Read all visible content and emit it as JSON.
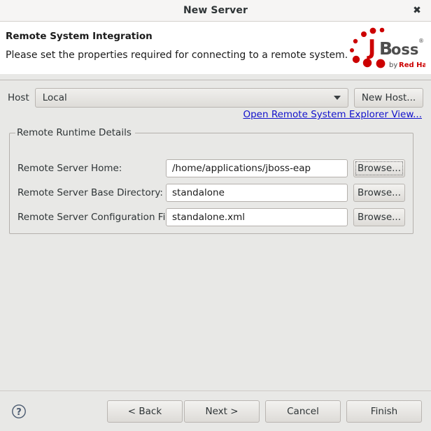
{
  "window": {
    "title": "New Server",
    "close_icon": "close-icon"
  },
  "header": {
    "title": "Remote System Integration",
    "description": "Please set the properties required for connecting to a remote system.",
    "logo": {
      "name": "jboss-logo",
      "wordmark_j": "J",
      "wordmark_boss": "Boss",
      "registered": "®",
      "byline_prefix": "by ",
      "byline_brand": "Red Hat",
      "brand_color": "#cc0000",
      "wordmark_color": "#4d4d4d"
    }
  },
  "host": {
    "label": "Host",
    "selected": "Local",
    "options": [
      "Local"
    ],
    "new_host_button": "New Host...",
    "explorer_link": "Open Remote System Explorer View...",
    "link_color": "#1111cc"
  },
  "runtime_group": {
    "legend": "Remote Runtime Details",
    "fields": [
      {
        "label": "Remote Server Home:",
        "value": "/home/applications/jboss-eap",
        "placeholder": "",
        "browse_label": "Browse...",
        "focused": true
      },
      {
        "label": "Remote Server Base Directory:",
        "value": "standalone",
        "placeholder": "",
        "browse_label": "Browse...",
        "focused": false
      },
      {
        "label": "Remote Server Configuration File:",
        "value": "standalone.xml",
        "placeholder": "",
        "browse_label": "Browse...",
        "focused": false
      }
    ]
  },
  "footer": {
    "help_icon": "help-icon",
    "back_label": "< Back",
    "next_label": "Next >",
    "cancel_label": "Cancel",
    "finish_label": "Finish"
  }
}
